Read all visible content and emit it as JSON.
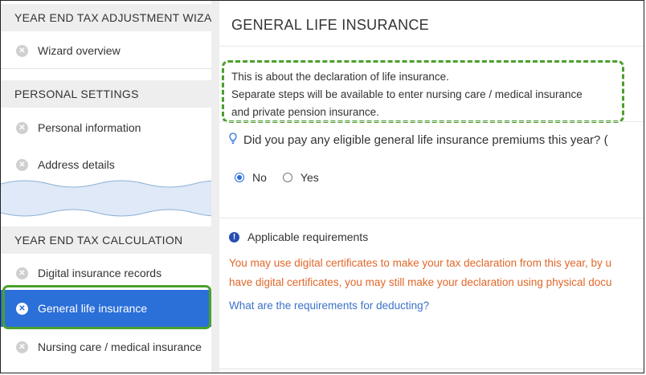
{
  "sidebar": {
    "sections": [
      {
        "header": "YEAR END TAX ADJUSTMENT WIZARD",
        "items": [
          {
            "label": "Wizard overview",
            "icon": "x-circle-icon"
          }
        ]
      },
      {
        "header": "PERSONAL SETTINGS",
        "items": [
          {
            "label": "Personal information",
            "icon": "x-circle-icon"
          },
          {
            "label": "Address details",
            "icon": "x-circle-icon"
          }
        ]
      },
      {
        "header": "YEAR END TAX CALCULATION",
        "items": [
          {
            "label": "Digital insurance records",
            "icon": "x-circle-icon"
          },
          {
            "label": "General life insurance",
            "icon": "x-circle-icon",
            "active": true
          },
          {
            "label": "Nursing care / medical insurance",
            "icon": "x-circle-icon"
          }
        ]
      }
    ]
  },
  "main": {
    "title": "GENERAL LIFE INSURANCE",
    "note": [
      "This is about the declaration of life insurance.",
      "Separate steps will be available to enter nursing care / medical insurance",
      "and private pension insurance."
    ],
    "question": "Did you pay any eligible general life insurance premiums this year? (",
    "radio_options": [
      {
        "label": "No",
        "selected": true
      },
      {
        "label": "Yes",
        "selected": false
      }
    ],
    "requirements_heading": "Applicable requirements",
    "warning_lines": [
      "You may use digital certificates to make your tax declaration from this year, by u",
      "have digital certificates, you may still make your declaration using physical docu"
    ],
    "requirements_link": "What are the requirements for deducting?"
  },
  "colors": {
    "accent": "#2b6fd9",
    "highlight_outline": "#4aa02c",
    "warning_text": "#e0672a",
    "link": "#3b72c8"
  }
}
